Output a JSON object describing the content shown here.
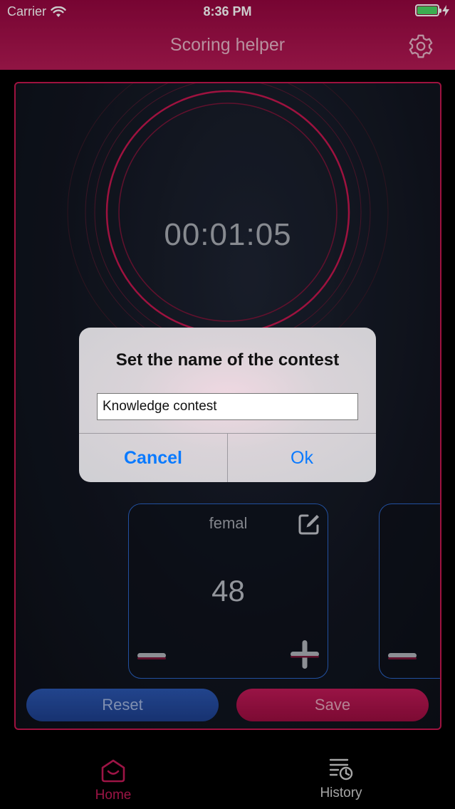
{
  "status_bar": {
    "carrier": "Carrier",
    "time": "8:36 PM"
  },
  "header": {
    "title": "Scoring helper",
    "settings_icon": "gear-icon"
  },
  "timer": {
    "display": "00:01:05"
  },
  "score_card": {
    "name": "femal",
    "score": "48",
    "edit_icon": "edit-icon",
    "minus_icon": "minus-icon",
    "plus_icon": "plus-icon"
  },
  "actions": {
    "reset_label": "Reset",
    "save_label": "Save"
  },
  "dialog": {
    "title": "Set the name of the contest",
    "input_value": "Knowledge contest",
    "cancel_label": "Cancel",
    "ok_label": "Ok"
  },
  "tab_bar": {
    "home_label": "Home",
    "history_label": "History"
  },
  "colors": {
    "accent": "#c41a57",
    "dialog_button": "#0a7aff",
    "card_border": "#2b65c8",
    "battery": "#4cd964"
  }
}
